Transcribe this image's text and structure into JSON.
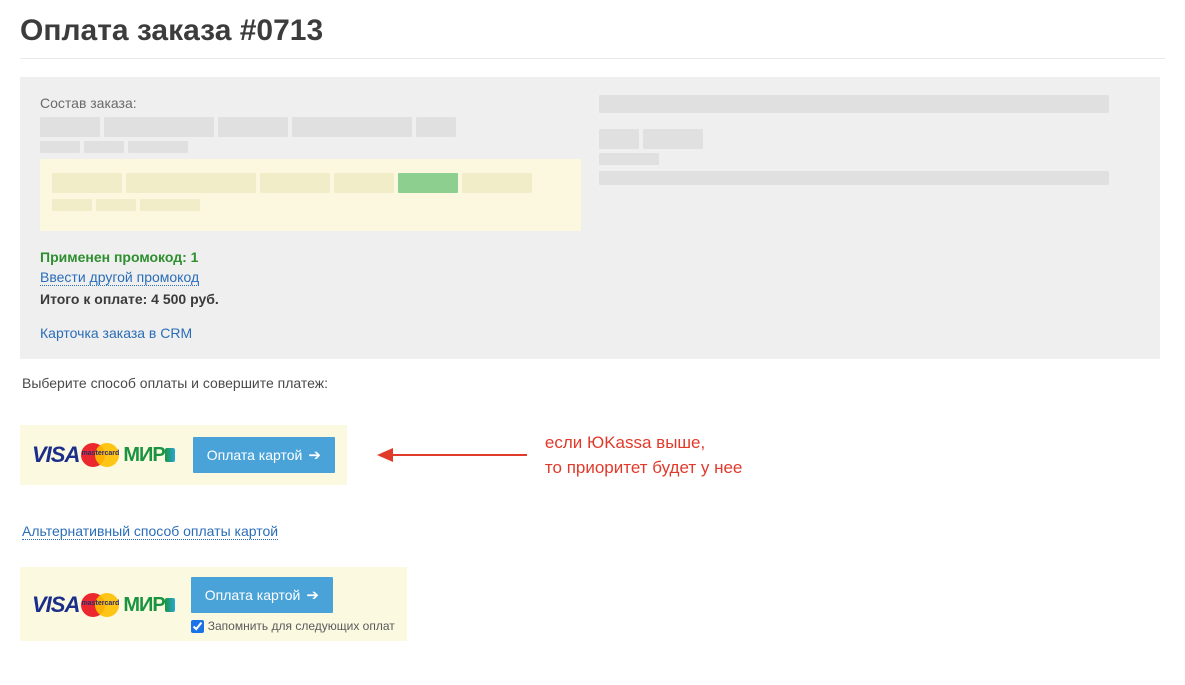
{
  "page_title": "Оплата заказа #0713",
  "order": {
    "composition_label": "Состав заказа:",
    "promo_applied": "Применен промокод: 1",
    "enter_other_promo": "Ввести другой промокод",
    "total_label": "Итого к оплате: 4 500 руб.",
    "crm_link": "Карточка заказа в CRM"
  },
  "instruction": "Выберите способ оплаты и совершите платеж:",
  "brands": {
    "visa": "VISA",
    "mastercard": "mastercard",
    "mir": "МИР"
  },
  "pay_button": "Оплата картой",
  "annotation": {
    "line1": "если ЮKassa выше,",
    "line2": "то приоритет будет у нее"
  },
  "alt_link": "Альтернативный способ оплаты картой",
  "remember_label": "Запомнить для следующих оплат"
}
